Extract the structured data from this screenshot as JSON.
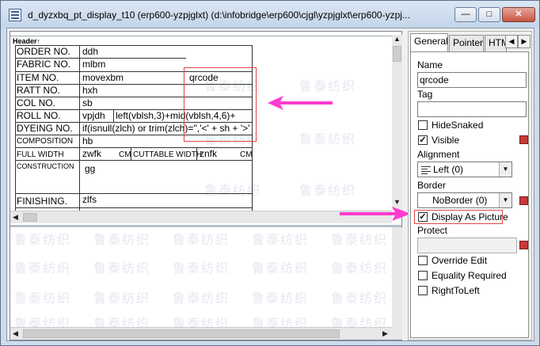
{
  "window": {
    "title": "d_dyzxbq_pt_display_t10  (erp600-yzpjglxt)  (d:\\infobridge\\erp600\\cjgl\\yzpjglxt\\erp600-yzpj...",
    "minimize": "—",
    "maximize": "□",
    "close": "✕"
  },
  "design": {
    "band_label": "Header↑",
    "watermark": "鲁泰纺织",
    "rows": [
      {
        "label": "ORDER NO.",
        "value": "ddh"
      },
      {
        "label": "FABRIC NO.",
        "value": "mlbm"
      },
      {
        "label": "ITEM NO.",
        "value": "movexbm"
      },
      {
        "label": "RATT NO.",
        "value": "hxh"
      },
      {
        "label": "COL NO.",
        "value": "sb"
      },
      {
        "label": "ROLL NO.",
        "value": "vpjdh"
      },
      {
        "label": "DYEING NO.",
        "value": "if(isnull(zlch) or trim(zlch)='','<' + sh + '>'"
      },
      {
        "label": "COMPOSITION",
        "value": "hb"
      },
      {
        "label": "FULL WIDTH",
        "value": "zwfk"
      },
      {
        "label": "CONSTRUCTION",
        "value": "gg"
      },
      {
        "label": "FINISHING.",
        "value": "zlfs"
      }
    ],
    "roll_expr": "left(vblsh,3)+mid(vblsh,4,6)+",
    "qrcode_field": "qrcode",
    "full_width_unit": "CM",
    "cuttable_label": "CUTTABLE WIDTH",
    "cuttable_value": "znfk",
    "cuttable_unit": "CM"
  },
  "props": {
    "tabs": [
      "General",
      "Pointer",
      "HTML"
    ],
    "name_label": "Name",
    "name_value": "qrcode",
    "tag_label": "Tag",
    "tag_value": "",
    "hide_snaked": "HideSnaked",
    "visible": "Visible",
    "alignment_label": "Alignment",
    "alignment_value": "Left (0)",
    "border_label": "Border",
    "border_value": "NoBorder (0)",
    "display_as_picture": "Display As Picture",
    "protect_label": "Protect",
    "override_edit": "Override Edit",
    "equality_required": "Equality Required",
    "right_to_left": "RightToLeft",
    "checks": {
      "hide_snaked": false,
      "visible": true,
      "display_as_picture": true,
      "override_edit": false,
      "equality_required": false,
      "right_to_left": false
    }
  },
  "colors": {
    "highlight_box": "#e04646",
    "arrow": "#ff3bd0"
  }
}
